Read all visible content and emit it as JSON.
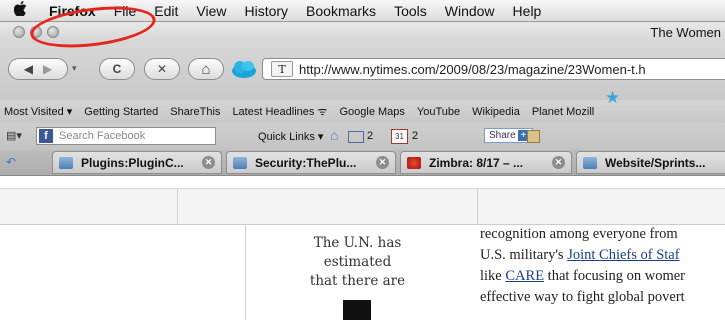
{
  "menubar": {
    "apple": "",
    "items": [
      "Firefox",
      "File",
      "Edit",
      "View",
      "History",
      "Bookmarks",
      "Tools",
      "Window",
      "Help"
    ]
  },
  "window": {
    "title": "The Women"
  },
  "nav": {
    "back": "◀",
    "forward": "▶",
    "reload": "C",
    "stop": "✕",
    "home": "⌂",
    "site_icon": "T",
    "url": "http://www.nytimes.com/2009/08/23/magazine/23Women-t.h"
  },
  "bookmarks": [
    "Most Visited ▾",
    "Getting Started",
    "ShareThis",
    "Latest Headlines ⁠ᯤ",
    "Google Maps",
    "YouTube",
    "Wikipedia",
    "Planet Mozill"
  ],
  "toolbar3": {
    "search_placeholder": "Search Facebook",
    "quick_links": "Quick Links ▾",
    "mail_count": "2",
    "cal_day": "31",
    "cal_count": "2",
    "share": "Share"
  },
  "tabs": [
    {
      "label": "Plugins:PluginC..."
    },
    {
      "label": "Security:ThePlu..."
    },
    {
      "label": "Zimbra: 8/17 – ..."
    },
    {
      "label": "Website/Sprints..."
    }
  ],
  "article": {
    "pullquote": [
      "The U.N. has",
      "estimated",
      "that there are"
    ],
    "body": {
      "line1": "recognition among everyone from",
      "line2_pre": "U.S. military's ",
      "line2_link": "Joint Chiefs of Staf",
      "line3_pre": "like ",
      "line3_link": "CARE",
      "line3_post": " that focusing on womer",
      "line4": "effective way to fight global povert"
    }
  },
  "colors": {
    "annotation": "#e8251c",
    "link": "#1a3f8f",
    "facebook": "#3b5998"
  }
}
